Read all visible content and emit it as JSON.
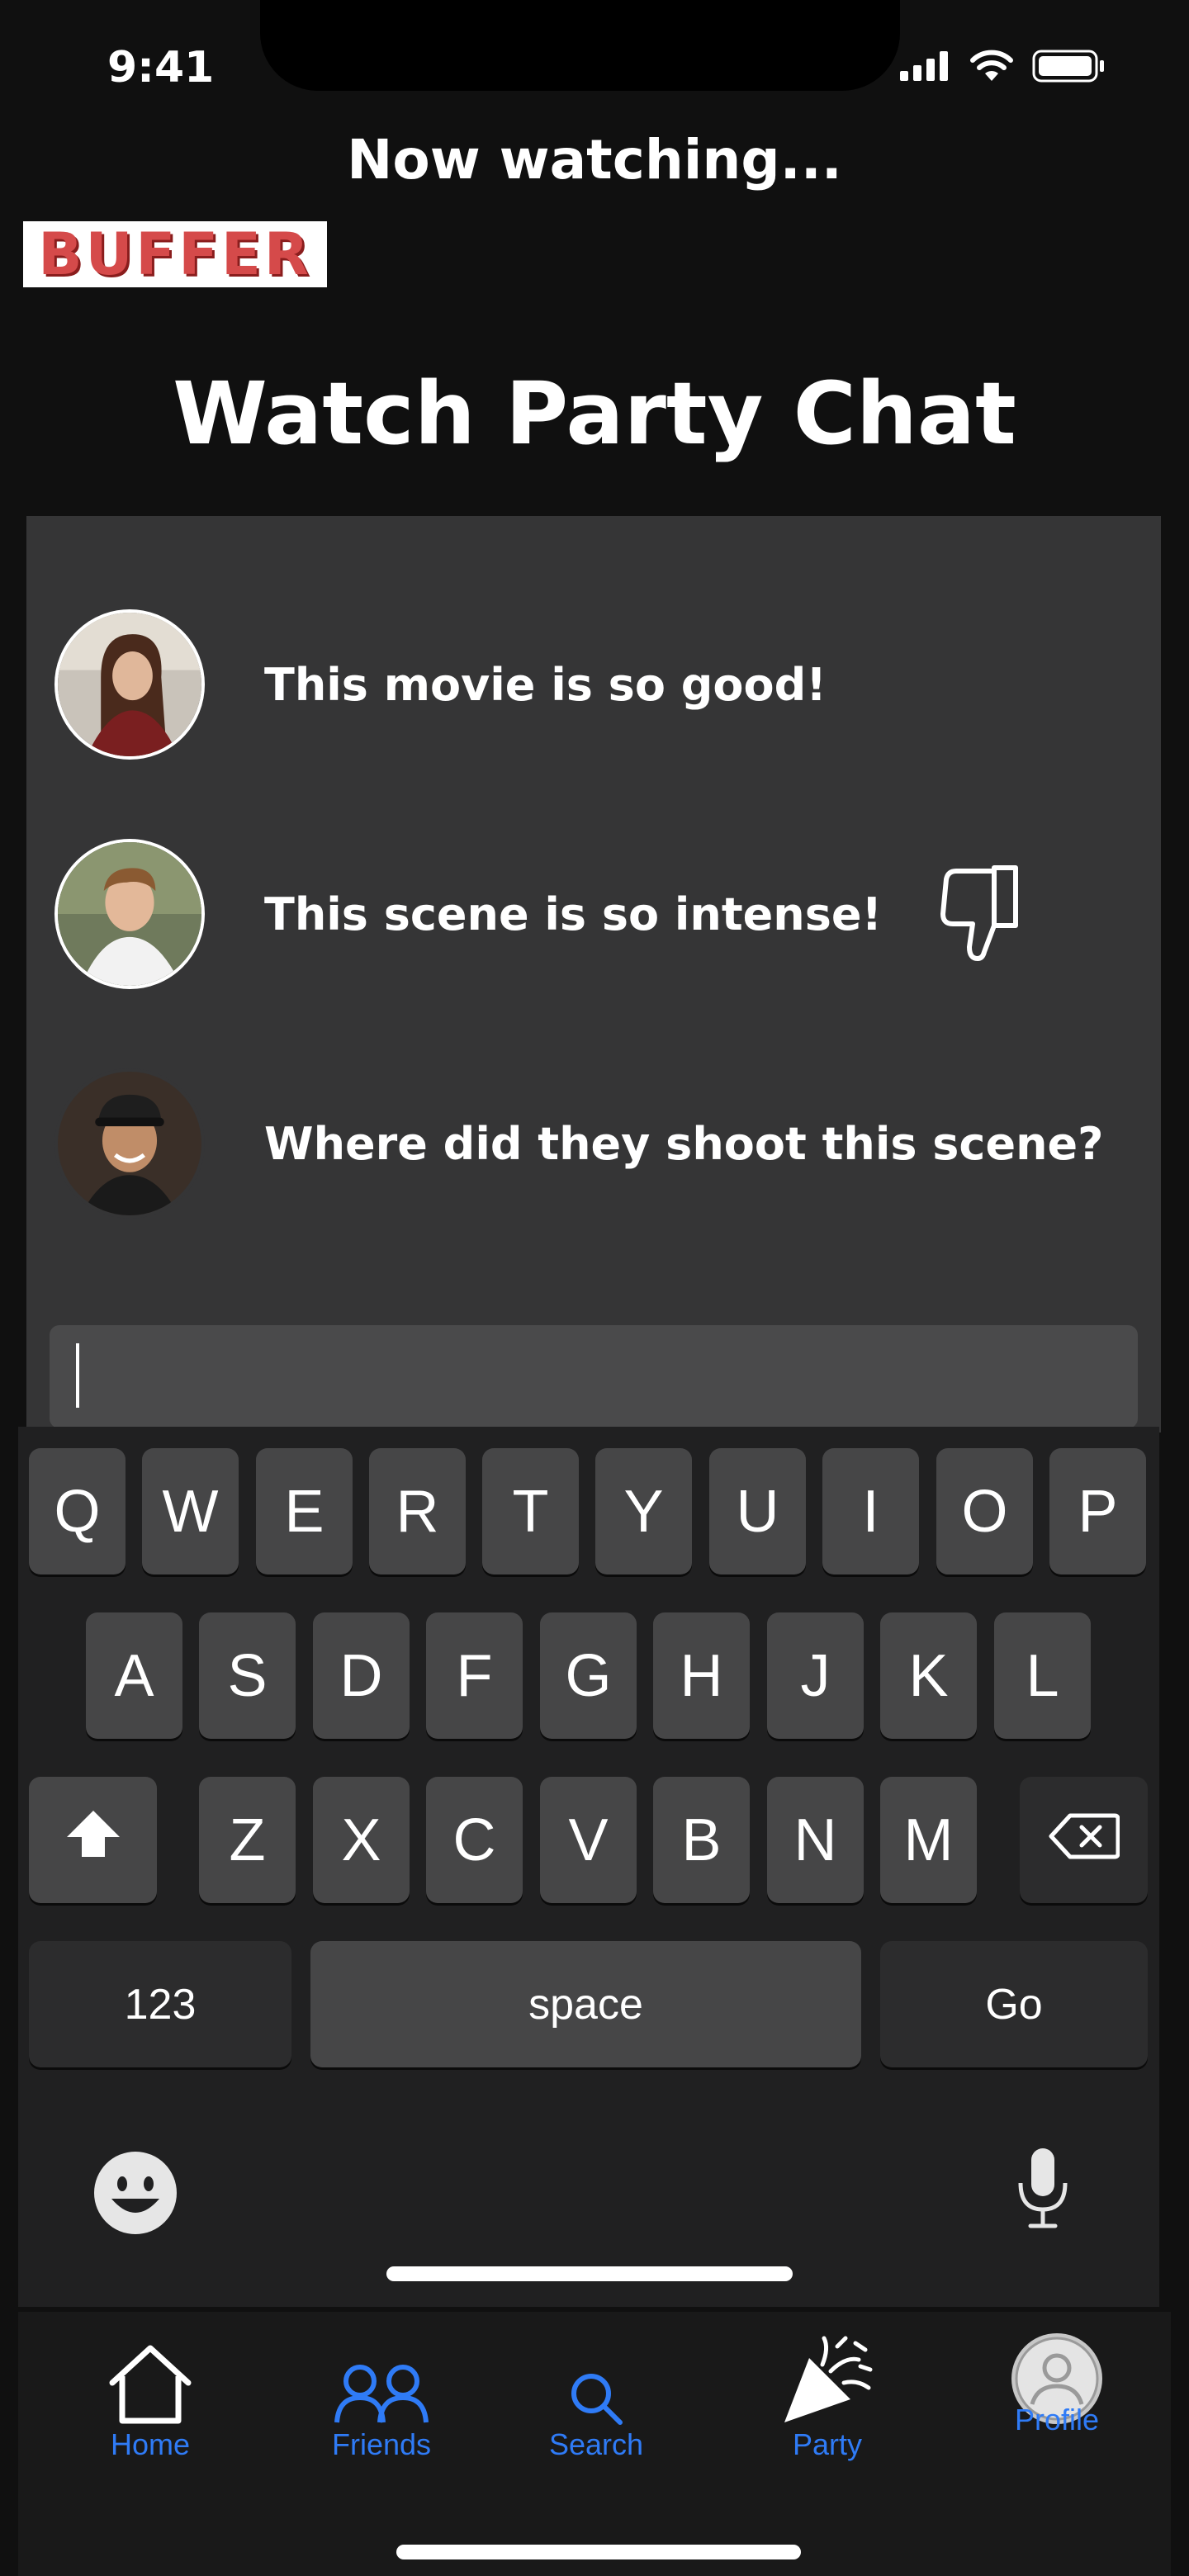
{
  "status_bar": {
    "time": "9:41"
  },
  "header": {
    "now_watching": "Now watching...",
    "movie_logo_text": "BUFFER",
    "chat_title": "Watch Party Chat"
  },
  "messages": [
    {
      "text": "This movie is so good!",
      "avatar": "avatar-woman-long-hair"
    },
    {
      "text": "This scene is so intense!",
      "avatar": "avatar-man-short-hair",
      "reaction": "thumbs-down-icon"
    },
    {
      "text": "Where did they shoot this scene?",
      "avatar": "avatar-man-cap"
    }
  ],
  "input": {
    "value": "",
    "placeholder": ""
  },
  "keyboard": {
    "row1": [
      "Q",
      "W",
      "E",
      "R",
      "T",
      "Y",
      "U",
      "I",
      "O",
      "P"
    ],
    "row2": [
      "A",
      "S",
      "D",
      "F",
      "G",
      "H",
      "J",
      "K",
      "L"
    ],
    "row3": [
      "Z",
      "X",
      "C",
      "V",
      "B",
      "N",
      "M"
    ],
    "numbers": "123",
    "space": "space",
    "go": "Go"
  },
  "tabs": [
    {
      "label": "Home",
      "icon": "home-icon"
    },
    {
      "label": "Friends",
      "icon": "friends-icon"
    },
    {
      "label": "Search",
      "icon": "search-icon"
    },
    {
      "label": "Party",
      "icon": "party-popper-icon"
    },
    {
      "label": "Profile",
      "icon": "profile-avatar-icon"
    }
  ],
  "colors": {
    "tab_accent": "#2f7bf6",
    "panel": "#353536",
    "background": "#101010",
    "logo_red": "#d54a4a"
  }
}
